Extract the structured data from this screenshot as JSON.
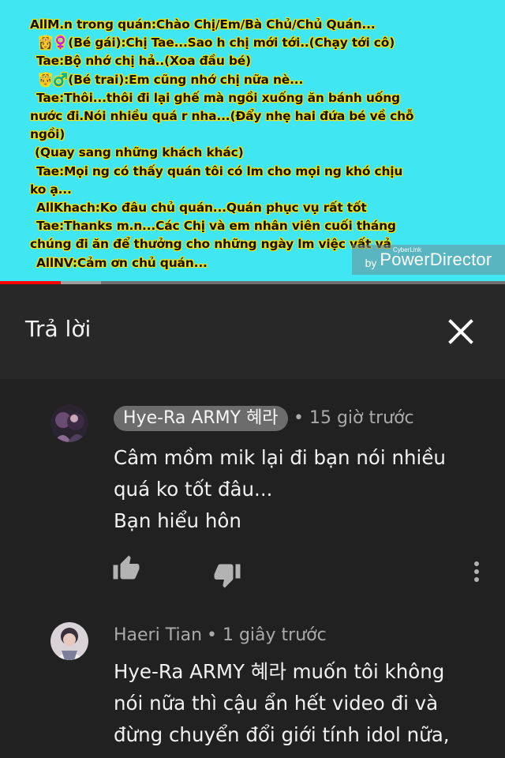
{
  "video": {
    "lines": [
      "AllM.n trong quán:Chào Chị/Em/Bà Chủ/Chủ Quán...",
      "👸♀️(Bé gái):Chị Tae...Sao h chị mới tới..(Chạy tới cô)",
      "Tae:Bộ nhớ chị hả..(Xoa đầu bé)",
      "🤴♂️(Bé trai):Em cũng nhớ chị nữa nè...",
      "Tae:Thôi...thôi đi lại ghế mà ngồi xuống ăn bánh uống",
      "nước đi.Nói nhiều quá r nha...(Đẩy nhẹ hai đứa bé về chỗ",
      "ngồi)",
      "(Quay sang những khách khác)",
      "Tae:Mọi ng có thấy quán tôi có lm cho mọi ng khó chịu",
      "ko ạ...",
      "AllKhach:Ko đâu chủ quán...Quán phục vụ rất tốt",
      "Tae:Thanks m.n...Các Chị và em nhân viên cuối tháng",
      "chúng đi ăn để thưởng cho những ngày lm việc vất vả",
      "AllNV:Cảm ơn chủ quán..."
    ],
    "watermark_by": "by",
    "watermark_brand": "PowerDirector",
    "watermark_small": "CyberLink",
    "progress_fraction": 0.12,
    "buffer_fraction": 0.2
  },
  "reply_panel": {
    "title": "Trả lời",
    "close_icon": "close-icon"
  },
  "comments": [
    {
      "author": "Hye-Ra ARMY 혜라",
      "time": "• 15 giờ trước",
      "text_lines": [
        "Câm mồm mik lại đi bạn nói nhiều",
        "quá ko tốt đâu...",
        "Bạn hiểu hôn"
      ],
      "icons": [
        "thumb-up-icon",
        "thumb-down-icon",
        "more-vert-icon"
      ]
    },
    {
      "author": "Haeri Tian",
      "time": "• 1 giây trước",
      "text_lines": [
        "Hye-Ra ARMY 혜라 muốn tôi không",
        "nói nữa thì cậu ẩn hết video đi và",
        "đừng chuyển đổi giới tính idol nữa,"
      ]
    }
  ],
  "colors": {
    "video_bg": "#41e6f3",
    "text_glow": "#ffe100",
    "panel_bg": "#282828",
    "page_bg": "#212121",
    "progress": "#ff0000"
  }
}
